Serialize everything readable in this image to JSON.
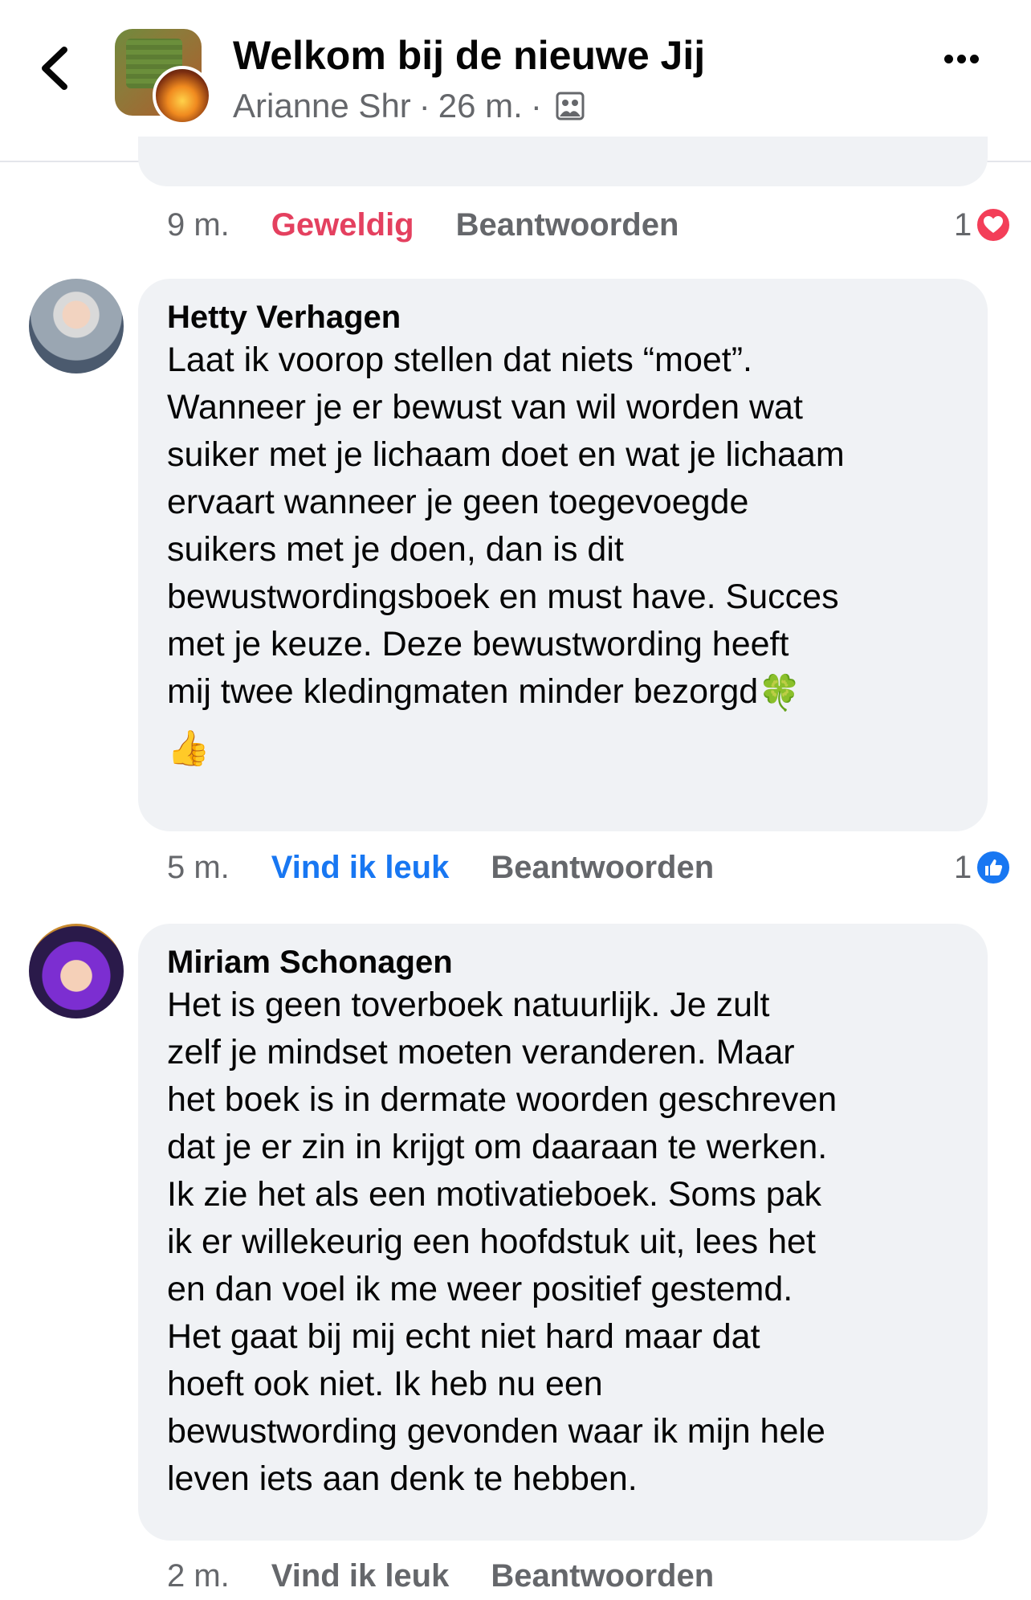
{
  "header": {
    "title": "Welkom bij de nieuwe Jij",
    "author": "Arianne Shr",
    "time": "26 m.",
    "dot": "·"
  },
  "prev_comment": {
    "time": "9 m.",
    "reaction_label": "Geweldig",
    "reply_label": "Beantwoorden",
    "reaction_count": "1",
    "reaction_type": "love"
  },
  "comments": [
    {
      "author": "Hetty Verhagen",
      "text": "Laat ik voorop stellen dat niets “moet”.\nWanneer je er bewust van wil worden wat\nsuiker met je lichaam doet en wat je lichaam\nervaart wanneer je geen toegevoegde\nsuikers met je doen, dan is dit\nbewustwordingsboek en must have. Succes\nmet je keuze. Deze bewustwording heeft\nmij twee kledingmaten minder bezorgd",
      "emoji1": "🍀",
      "emoji2": "👍",
      "time": "5 m.",
      "reaction_label": "Vind ik leuk",
      "reply_label": "Beantwoorden",
      "reaction_count": "1",
      "reaction_type": "like"
    },
    {
      "author": "Miriam Schonagen",
      "text": "Het is geen toverboek natuurlijk.  Je zult\nzelf je mindset moeten veranderen.  Maar\nhet boek is in dermate woorden geschreven\ndat je er zin in krijgt om daaraan te werken.\nIk zie het als een motivatieboek. Soms pak\nik er willekeurig een hoofdstuk uit,  lees het\nen dan voel ik me weer positief gestemd.\nHet gaat bij mij echt niet hard maar dat\nhoeft ook niet.  Ik heb nu een\nbewustwording gevonden waar ik mijn hele\nleven iets aan denk te hebben.",
      "time": "2 m.",
      "reaction_label": "Vind ik leuk",
      "reply_label": "Beantwoorden"
    }
  ],
  "colors": {
    "love": "#f33e58",
    "like": "#1877f2",
    "muted": "#65676b",
    "bubble": "#f0f2f5"
  }
}
